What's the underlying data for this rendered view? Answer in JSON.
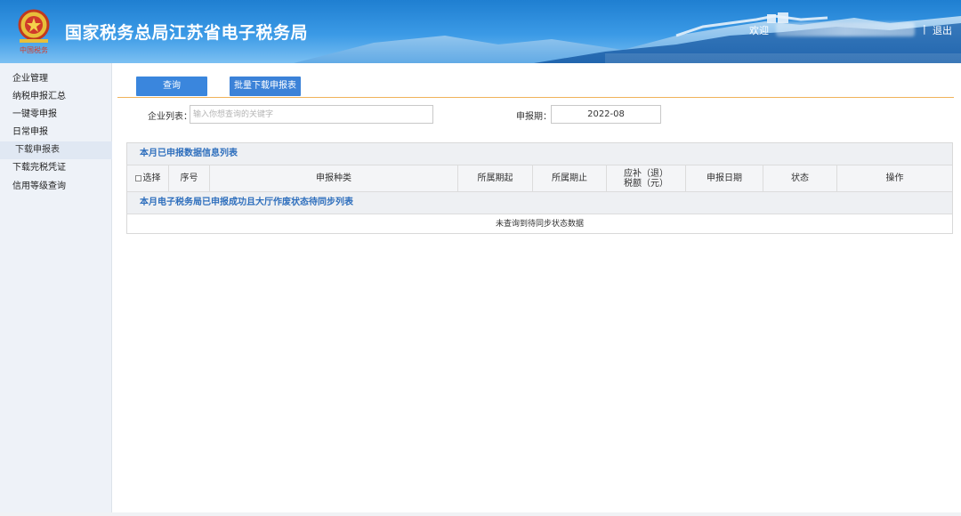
{
  "header": {
    "title": "国家税务总局江苏省电子税务局",
    "emblem_caption": "中国税务",
    "welcome": "欢迎",
    "separator": "|",
    "logout": "退出"
  },
  "sidebar": {
    "items": [
      {
        "label": "企业管理"
      },
      {
        "label": "纳税申报汇总"
      },
      {
        "label": "一键零申报"
      },
      {
        "label": "日常申报"
      },
      {
        "label": "下载申报表"
      },
      {
        "label": "下载完税凭证"
      },
      {
        "label": "信用等级查询"
      }
    ],
    "active_index": 4
  },
  "toolbar": {
    "query_label": "查询",
    "batch_download_label": "批量下载申报表"
  },
  "filters": {
    "company_label": "企业列表：",
    "company_placeholder": "输入你想查询的关键字",
    "period_label": "申报期：",
    "period_value": "2022-08"
  },
  "table": {
    "section1_title": "本月已申报数据信息列表",
    "headers": {
      "select": "选择",
      "seq": "序号",
      "type": "申报种类",
      "period_start": "所属期起",
      "period_end": "所属期止",
      "tax_line1": "应补（退）",
      "tax_line2": "税额（元）",
      "date": "申报日期",
      "status": "状态",
      "action": "操作"
    },
    "section2_title": "本月电子税务局已申报成功且大厅作废状态待同步列表",
    "empty_text": "未查询到待同步状态数据"
  },
  "colors": {
    "header_blue": "#1f7fd1",
    "button_blue": "#3a86dd",
    "section_title_blue": "#2f6fbd",
    "divider_orange": "#f0b35a"
  }
}
